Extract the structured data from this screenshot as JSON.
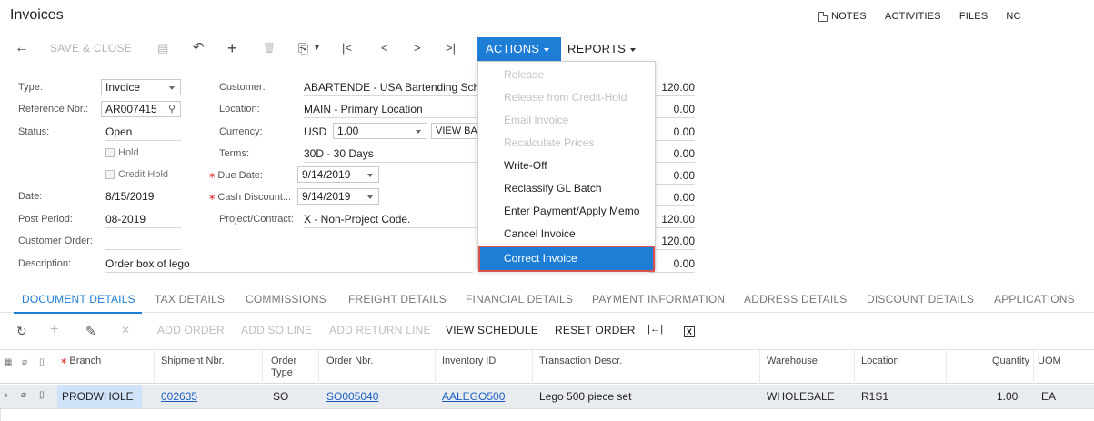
{
  "page": {
    "title": "Invoices"
  },
  "top_links": {
    "notes": "NOTES",
    "activities": "ACTIVITIES",
    "files": "FILES",
    "more": "NC"
  },
  "toolbar": {
    "back": "←",
    "save_close": "SAVE & CLOSE",
    "save": "▤",
    "undo": "↶",
    "add": "+",
    "delete": "🗑",
    "copy": "⎘",
    "copy_caret": "▾",
    "first": "|<",
    "prev": "<",
    "next": ">",
    "last": ">|",
    "actions": "ACTIONS",
    "reports": "REPORTS"
  },
  "actions_menu": [
    {
      "label": "Release",
      "enabled": false
    },
    {
      "label": "Release from Credit-Hold",
      "enabled": false
    },
    {
      "label": "Email Invoice",
      "enabled": false
    },
    {
      "label": "Recalculate Prices",
      "enabled": false
    },
    {
      "label": "Write-Off",
      "enabled": true
    },
    {
      "label": "Reclassify GL Batch",
      "enabled": true
    },
    {
      "label": "Enter Payment/Apply Memo",
      "enabled": true
    },
    {
      "label": "Cancel Invoice",
      "enabled": true
    },
    {
      "label": "Correct Invoice",
      "enabled": true,
      "selected": true
    }
  ],
  "form": {
    "type_label": "Type:",
    "type_value": "Invoice",
    "refnbr_label": "Reference Nbr.:",
    "refnbr_value": "AR007415",
    "status_label": "Status:",
    "status_value": "Open",
    "hold_label": "Hold",
    "credit_hold_label": "Credit Hold",
    "date_label": "Date:",
    "date_value": "8/15/2019",
    "post_period_label": "Post Period:",
    "post_period_value": "08-2019",
    "customer_order_label": "Customer Order:",
    "description_label": "Description:",
    "description_value": "Order box of lego",
    "customer_label": "Customer:",
    "customer_value": "ABARTENDE - USA Bartending Scho",
    "location_label": "Location:",
    "location_value": "MAIN - Primary Location",
    "currency_label": "Currency:",
    "currency_value": "USD",
    "currency_rate": "1.00",
    "view_base": "VIEW BA",
    "terms_label": "Terms:",
    "terms_value": "30D - 30 Days",
    "due_date_label": "Due Date:",
    "due_date_value": "9/14/2019",
    "cash_discount_label": "Cash Discount...",
    "cash_discount_value": "9/14/2019",
    "project_label": "Project/Contract:",
    "project_value": "X - Non-Project Code.",
    "amounts": [
      "120.00",
      "0.00",
      "0.00",
      "0.00",
      "0.00",
      "0.00",
      "120.00",
      "120.00",
      "0.00"
    ]
  },
  "tabs": [
    "DOCUMENT DETAILS",
    "TAX DETAILS",
    "COMMISSIONS",
    "FREIGHT DETAILS",
    "FINANCIAL DETAILS",
    "PAYMENT INFORMATION",
    "ADDRESS DETAILS",
    "DISCOUNT DETAILS",
    "APPLICATIONS"
  ],
  "grid_toolbar": {
    "refresh": "↻",
    "add": "+",
    "edit": "✎",
    "delete": "✕",
    "add_order": "ADD ORDER",
    "add_so_line": "ADD SO LINE",
    "add_return_line": "ADD RETURN LINE",
    "view_schedule": "VIEW SCHEDULE",
    "reset_order": "RESET ORDER",
    "fit": "|↔|",
    "excel": "X"
  },
  "grid": {
    "headers": {
      "branch": "Branch",
      "shipment": "Shipment Nbr.",
      "order_type_1": "Order",
      "order_type_2": "Type",
      "order_nbr": "Order Nbr.",
      "inventory": "Inventory ID",
      "descr": "Transaction Descr.",
      "warehouse": "Warehouse",
      "location": "Location",
      "quantity": "Quantity",
      "uom": "UOM"
    },
    "rows": [
      {
        "branch": "PRODWHOLE",
        "shipment": "002635",
        "order_type": "SO",
        "order_nbr": "SO005040",
        "inventory": "AALEGO500",
        "descr": "Lego 500 piece set",
        "warehouse": "WHOLESALE",
        "location": "R1S1",
        "quantity": "1.00",
        "uom": "EA"
      }
    ]
  },
  "colors": {
    "accent": "#1e7ed6",
    "highlight_border": "#d9534f",
    "row_bg": "#e9ecef",
    "link": "#1a5fc4"
  }
}
